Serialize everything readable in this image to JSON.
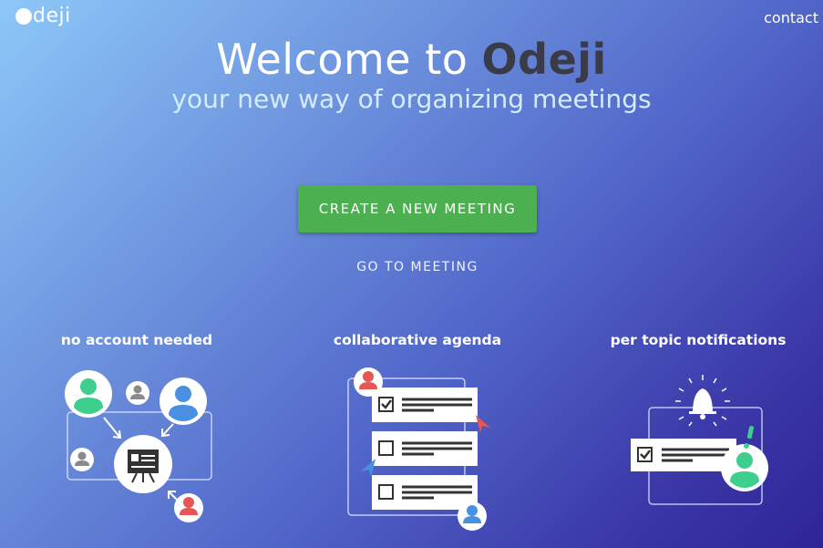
{
  "header": {
    "logo_text": "deji",
    "contact_label": "contact"
  },
  "hero": {
    "title_prefix": "Welcome to",
    "title_brand": "Odeji",
    "subtitle": "your new way of organizing meetings"
  },
  "actions": {
    "create_label": "CREATE A NEW MEETING",
    "goto_label": "GO TO MEETING"
  },
  "features": [
    {
      "title": "no account needed",
      "icon": "presentation-icon"
    },
    {
      "title": "collaborative agenda",
      "icon": "checklist-icon"
    },
    {
      "title": "per topic notifications",
      "icon": "bell-icon"
    }
  ],
  "colors": {
    "primary_button": "#4caf50",
    "brand_dark": "#3b3b48",
    "subtitle": "#d4ecff",
    "avatar_green": "#3ecf8e",
    "avatar_blue": "#4a90e2",
    "avatar_red": "#e85555",
    "avatar_gray": "#8a8a8a"
  }
}
